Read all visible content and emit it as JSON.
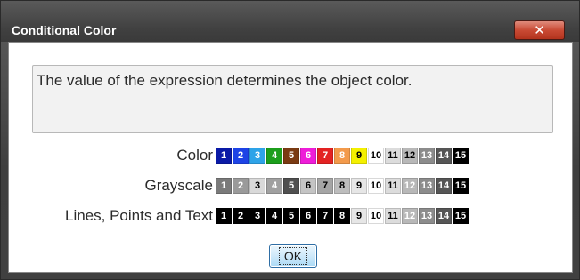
{
  "window": {
    "title": "Conditional Color",
    "close_glyph": "✕"
  },
  "expression": {
    "text": "The value of the expression determines the object color."
  },
  "rows": [
    {
      "label": "Color",
      "swatches": [
        {
          "n": "1",
          "bg": "#0a1aa6",
          "fg": "#ffffff"
        },
        {
          "n": "2",
          "bg": "#1d43e6",
          "fg": "#ffffff"
        },
        {
          "n": "3",
          "bg": "#2ea3e8",
          "fg": "#ffffff"
        },
        {
          "n": "4",
          "bg": "#1c9e1c",
          "fg": "#ffffff"
        },
        {
          "n": "5",
          "bg": "#7a3a12",
          "fg": "#ffffff"
        },
        {
          "n": "6",
          "bg": "#ee1cd8",
          "fg": "#ffffff"
        },
        {
          "n": "7",
          "bg": "#e32222",
          "fg": "#ffffff"
        },
        {
          "n": "8",
          "bg": "#f39a4b",
          "fg": "#ffffff"
        },
        {
          "n": "9",
          "bg": "#f4f000",
          "fg": "#000000"
        },
        {
          "n": "10",
          "bg": "#ffffff",
          "fg": "#000000"
        },
        {
          "n": "11",
          "bg": "#dcdcdc",
          "fg": "#000000"
        },
        {
          "n": "12",
          "bg": "#b8b8b8",
          "fg": "#000000"
        },
        {
          "n": "13",
          "bg": "#8c8c8c",
          "fg": "#ffffff"
        },
        {
          "n": "14",
          "bg": "#555555",
          "fg": "#ffffff"
        },
        {
          "n": "15",
          "bg": "#000000",
          "fg": "#ffffff"
        }
      ]
    },
    {
      "label": "Grayscale",
      "swatches": [
        {
          "n": "1",
          "bg": "#7a7a7a",
          "fg": "#ffffff"
        },
        {
          "n": "2",
          "bg": "#9a9a9a",
          "fg": "#ffffff"
        },
        {
          "n": "3",
          "bg": "#d9d9d9",
          "fg": "#000000"
        },
        {
          "n": "4",
          "bg": "#a0a0a0",
          "fg": "#ffffff"
        },
        {
          "n": "5",
          "bg": "#4f4f4f",
          "fg": "#ffffff"
        },
        {
          "n": "6",
          "bg": "#c4c4c4",
          "fg": "#000000"
        },
        {
          "n": "7",
          "bg": "#a5a5a5",
          "fg": "#000000"
        },
        {
          "n": "8",
          "bg": "#bdbdbd",
          "fg": "#000000"
        },
        {
          "n": "9",
          "bg": "#e6e6e6",
          "fg": "#000000"
        },
        {
          "n": "10",
          "bg": "#ffffff",
          "fg": "#000000"
        },
        {
          "n": "11",
          "bg": "#dcdcdc",
          "fg": "#000000"
        },
        {
          "n": "12",
          "bg": "#b8b8b8",
          "fg": "#ffffff"
        },
        {
          "n": "13",
          "bg": "#8c8c8c",
          "fg": "#ffffff"
        },
        {
          "n": "14",
          "bg": "#555555",
          "fg": "#ffffff"
        },
        {
          "n": "15",
          "bg": "#000000",
          "fg": "#ffffff"
        }
      ]
    },
    {
      "label": "Lines, Points and Text",
      "swatches": [
        {
          "n": "1",
          "bg": "#000000",
          "fg": "#ffffff"
        },
        {
          "n": "2",
          "bg": "#000000",
          "fg": "#ffffff"
        },
        {
          "n": "3",
          "bg": "#000000",
          "fg": "#ffffff"
        },
        {
          "n": "4",
          "bg": "#000000",
          "fg": "#ffffff"
        },
        {
          "n": "5",
          "bg": "#000000",
          "fg": "#ffffff"
        },
        {
          "n": "6",
          "bg": "#000000",
          "fg": "#ffffff"
        },
        {
          "n": "7",
          "bg": "#000000",
          "fg": "#ffffff"
        },
        {
          "n": "8",
          "bg": "#000000",
          "fg": "#ffffff"
        },
        {
          "n": "9",
          "bg": "#e6e6e6",
          "fg": "#000000"
        },
        {
          "n": "10",
          "bg": "#ffffff",
          "fg": "#000000"
        },
        {
          "n": "11",
          "bg": "#dcdcdc",
          "fg": "#000000"
        },
        {
          "n": "12",
          "bg": "#b8b8b8",
          "fg": "#ffffff"
        },
        {
          "n": "13",
          "bg": "#8c8c8c",
          "fg": "#ffffff"
        },
        {
          "n": "14",
          "bg": "#555555",
          "fg": "#ffffff"
        },
        {
          "n": "15",
          "bg": "#000000",
          "fg": "#ffffff"
        }
      ]
    }
  ],
  "buttons": {
    "ok_label": "OK"
  }
}
